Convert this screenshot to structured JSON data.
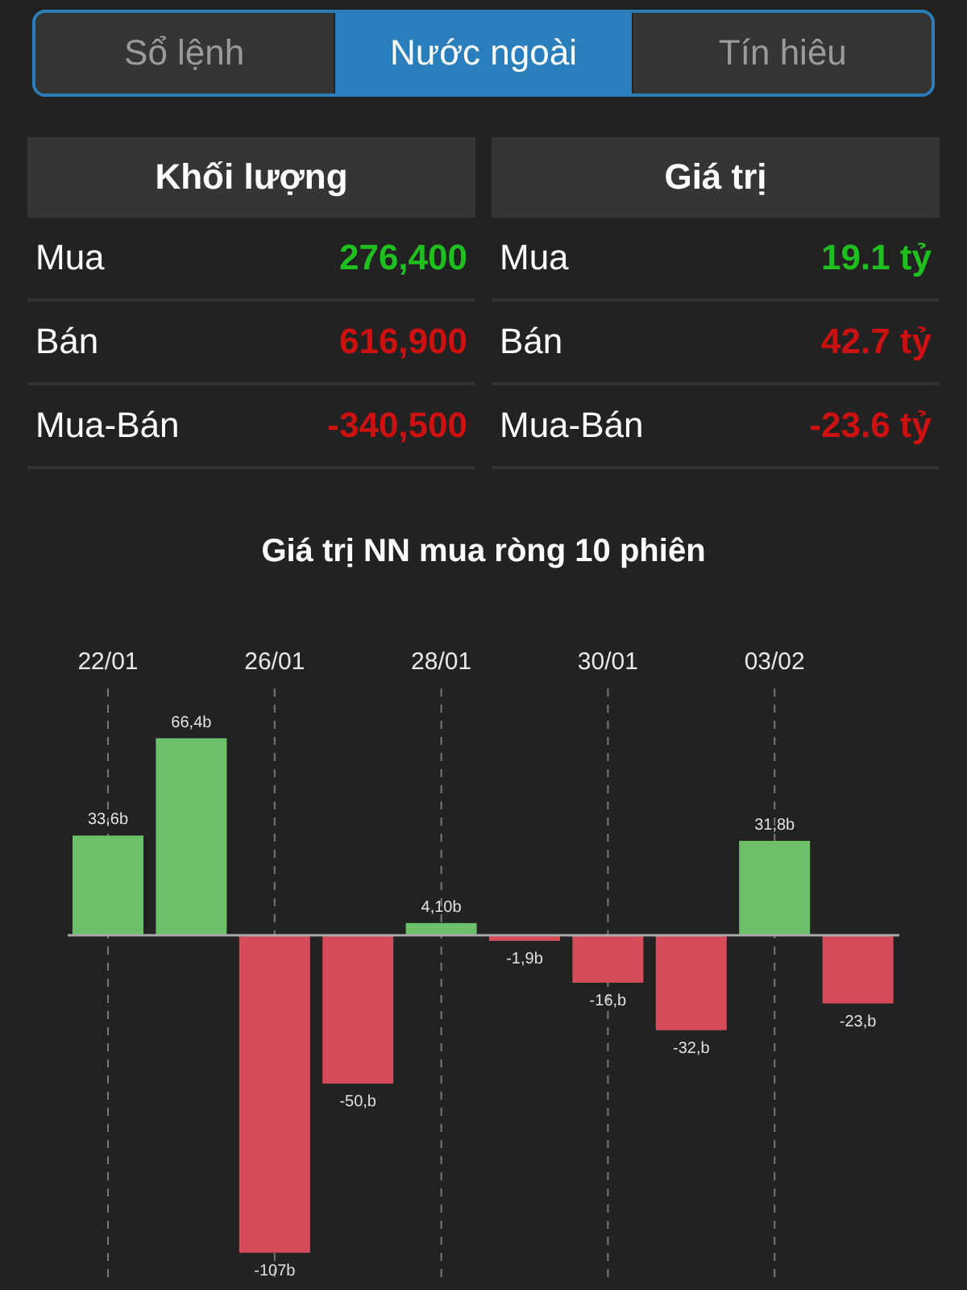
{
  "tabs": [
    {
      "label": "Sổ lệnh",
      "selected": false
    },
    {
      "label": "Nước ngoài",
      "selected": true
    },
    {
      "label": "Tín hiêu",
      "selected": false
    }
  ],
  "tables": [
    {
      "title": "Khối lượng",
      "rows": [
        {
          "label": "Mua",
          "value": "276,400",
          "color": "#1fbf1f"
        },
        {
          "label": "Bán",
          "value": "616,900",
          "color": "#cc1111"
        },
        {
          "label": "Mua-Bán",
          "value": "-340,500",
          "color": "#cc1111"
        }
      ]
    },
    {
      "title": "Giá trị",
      "rows": [
        {
          "label": "Mua",
          "value": "19.1 tỷ",
          "color": "#1fbf1f"
        },
        {
          "label": "Bán",
          "value": "42.7 tỷ",
          "color": "#cc1111"
        },
        {
          "label": "Mua-Bán",
          "value": "-23.6 tỷ",
          "color": "#cc1111"
        }
      ]
    }
  ],
  "chart": {
    "title": "Giá trị NN mua ròng 10 phiên",
    "chart_data": {
      "type": "bar",
      "values": [
        33.6,
        66.4,
        -107,
        -50,
        4.1,
        -1.9,
        -16,
        -32,
        31.8,
        -23
      ],
      "value_labels": [
        "33,6b",
        "66,4b",
        "-107b",
        "-50,b",
        "4,10b",
        "-1,9b",
        "-16,b",
        "-32,b",
        "31,8b",
        "-23,b"
      ],
      "grid": true,
      "categories": [
        "22/01",
        null,
        "26/01",
        null,
        "28/01",
        null,
        "30/01",
        null,
        "03/02",
        null
      ]
    }
  }
}
